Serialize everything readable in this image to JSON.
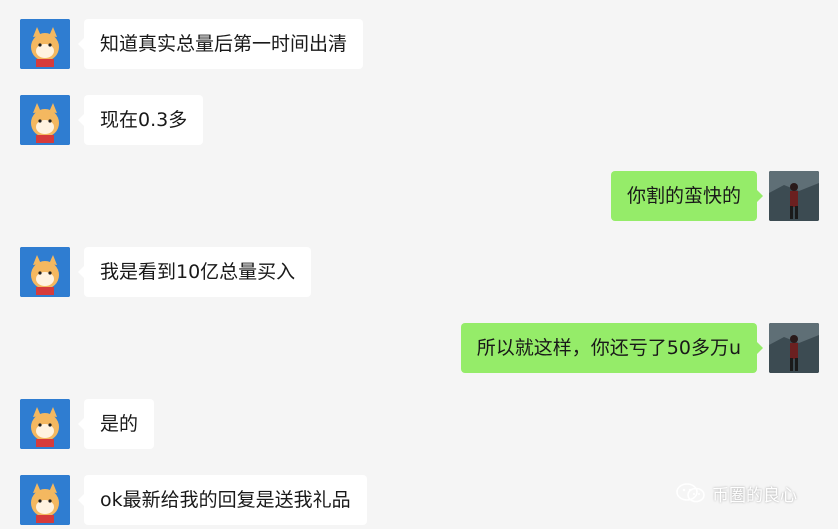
{
  "messages": [
    {
      "side": "in",
      "text": "知道真实总量后第一时间出清",
      "avatar": "shiba-dog-avatar"
    },
    {
      "side": "in",
      "text": "现在0.3多",
      "avatar": "shiba-dog-avatar"
    },
    {
      "side": "out",
      "text": "你割的蛮快的",
      "avatar": "dark-figure-avatar"
    },
    {
      "side": "in",
      "text": "我是看到10亿总量买入",
      "avatar": "shiba-dog-avatar"
    },
    {
      "side": "out",
      "text": "所以就这样，你还亏了50多万u",
      "avatar": "dark-figure-avatar"
    },
    {
      "side": "in",
      "text": "是的",
      "avatar": "shiba-dog-avatar"
    },
    {
      "side": "in",
      "text": "ok最新给我的回复是送我礼品",
      "avatar": "shiba-dog-avatar"
    }
  ],
  "watermark": {
    "text": "币圈的良心",
    "icon": "wechat-official-account-icon"
  },
  "colors": {
    "background": "#f5f5f5",
    "incoming_bubble": "#ffffff",
    "outgoing_bubble": "#95ec69"
  }
}
